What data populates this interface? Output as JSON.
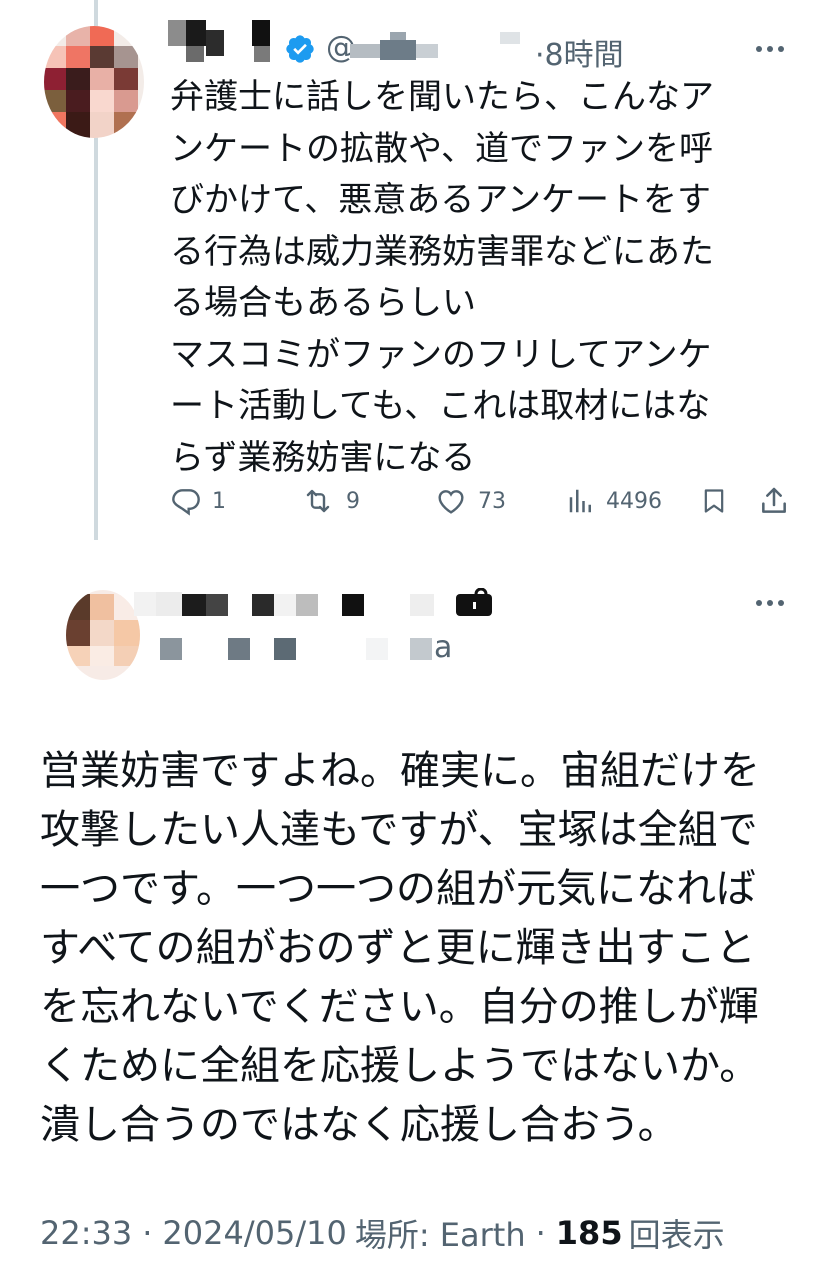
{
  "parent_tweet": {
    "handle_prefix": "@",
    "timestamp": "·8時間",
    "verified_icon": "verified-badge-icon",
    "text_lines": [
      "弁護士に話しを聞いたら、こんなア",
      "ンケートの拡散や、道でファンを呼",
      "びかけて、悪意あるアンケートをす",
      "る行為は威力業務妨害罪などにあた",
      "る場合もあるらしい",
      "マスコミがファンのフリしてアンケ",
      "ート活動しても、これは取材にはな",
      "らず業務妨害になる"
    ],
    "actions": {
      "reply_count": "1",
      "retweet_count": "9",
      "like_count": "73",
      "views_count": "4496"
    },
    "icons": [
      "reply-icon",
      "retweet-icon",
      "like-icon",
      "views-icon",
      "bookmark-icon",
      "share-icon"
    ]
  },
  "focused_tweet": {
    "handle_suffix": "a",
    "lock_icon": "protected-lock-icon",
    "text_lines": [
      "営業妨害ですよね。確実に。宙組だけを",
      "攻撃したい人達もですが、宝塚は全組で",
      "一つです。一つ一つの組が元気になれば",
      "すべての組がおのずと更に輝き出すこと",
      "を忘れないでください。自分の推しが輝",
      "くために全組を応援しようではないか。",
      "潰し合うのではなく応援し合おう。"
    ],
    "meta": {
      "time": "22:33",
      "date": "2024/05/10",
      "location": "場所: Earth",
      "views_number": "185",
      "views_label": "回表示"
    }
  },
  "colors": {
    "text": "#0f1419",
    "secondary": "#536471",
    "verified": "#1d9bf0",
    "thread_line": "#cfd9de"
  }
}
